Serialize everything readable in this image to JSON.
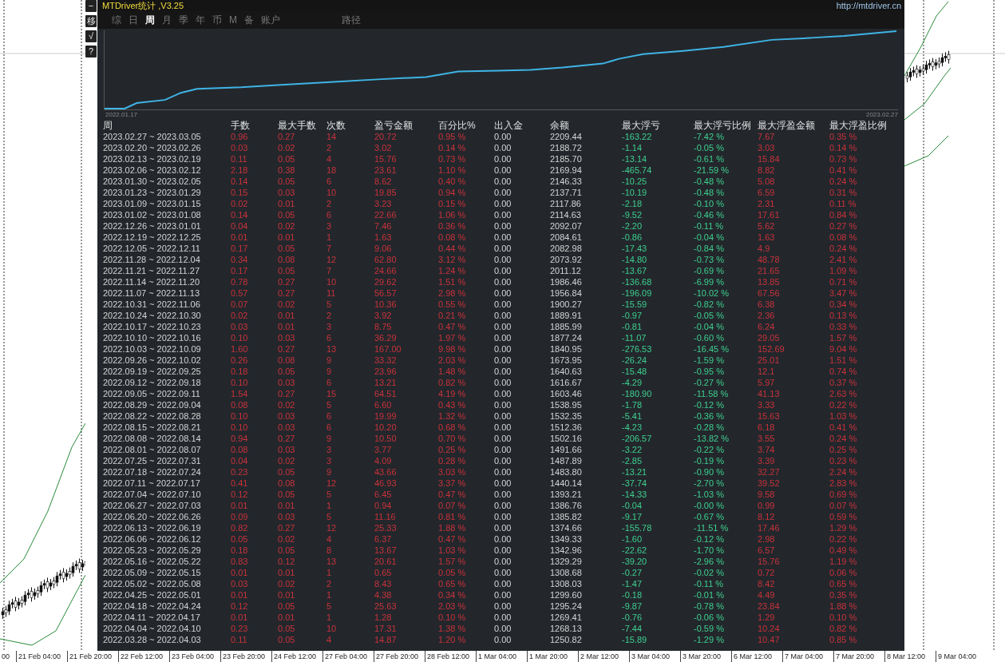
{
  "side_buttons": [
    "−",
    "移",
    "√",
    "?"
  ],
  "window": {
    "title": "MTDriver统计 ,V3.25",
    "link": "http://mtdriver.cn"
  },
  "tabs": [
    {
      "label": "综",
      "selected": false
    },
    {
      "label": "日",
      "selected": false
    },
    {
      "label": "周",
      "selected": true
    },
    {
      "label": "月",
      "selected": false
    },
    {
      "label": "季",
      "selected": false
    },
    {
      "label": "年",
      "selected": false
    },
    {
      "label": "币",
      "selected": false
    },
    {
      "label": "M",
      "selected": false
    },
    {
      "label": "备",
      "selected": false
    },
    {
      "label": "账户",
      "selected": false
    },
    {
      "label": "路径",
      "selected": false
    }
  ],
  "equity_chart": {
    "start_label": "2022.01.17",
    "end_label": "2023.02.27"
  },
  "table": {
    "columns": [
      {
        "label": "周",
        "kind": "plain"
      },
      {
        "label": "手数",
        "kind": "profit"
      },
      {
        "label": "最大手数",
        "kind": "profit"
      },
      {
        "label": "次数",
        "kind": "profit"
      },
      {
        "label": "盈亏金额",
        "kind": "profit"
      },
      {
        "label": "百分比%",
        "kind": "profit"
      },
      {
        "label": "出入金",
        "kind": "plain"
      },
      {
        "label": "余额",
        "kind": "plain"
      },
      {
        "label": "最大浮亏",
        "kind": "loss"
      },
      {
        "label": "最大浮亏比例",
        "kind": "loss"
      },
      {
        "label": "最大浮盈金额",
        "kind": "profit"
      },
      {
        "label": "最大浮盈比例",
        "kind": "profit"
      }
    ],
    "rows": [
      [
        "2023.02.27 ~ 2023.03.05",
        "0.96",
        "0.27",
        "14",
        "20.72",
        "0.95 %",
        "0.00",
        "2209.44",
        "-163.22",
        "-7.42 %",
        "7.67",
        "0.35 %"
      ],
      [
        "2023.02.20 ~ 2023.02.26",
        "0.03",
        "0.02",
        "2",
        "3.02",
        "0.14 %",
        "0.00",
        "2188.72",
        "-1.14",
        "-0.05 %",
        "3.03",
        "0.14 %"
      ],
      [
        "2023.02.13 ~ 2023.02.19",
        "0.11",
        "0.05",
        "4",
        "15.76",
        "0.73 %",
        "0.00",
        "2185.70",
        "-13.14",
        "-0.61 %",
        "15.84",
        "0.73 %"
      ],
      [
        "2023.02.06 ~ 2023.02.12",
        "2.18",
        "0.38",
        "18",
        "23.61",
        "1.10 %",
        "0.00",
        "2169.94",
        "-465.74",
        "-21.59 %",
        "8.82",
        "0.41 %"
      ],
      [
        "2023.01.30 ~ 2023.02.05",
        "0.14",
        "0.05",
        "6",
        "8.62",
        "0.40 %",
        "0.00",
        "2146.33",
        "-10.25",
        "-0.48 %",
        "5.08",
        "0.24 %"
      ],
      [
        "2023.01.23 ~ 2023.01.29",
        "0.15",
        "0.03",
        "10",
        "19.85",
        "0.94 %",
        "0.00",
        "2137.71",
        "-10.19",
        "-0.48 %",
        "6.59",
        "0.31 %"
      ],
      [
        "2023.01.09 ~ 2023.01.15",
        "0.02",
        "0.01",
        "2",
        "3.23",
        "0.15 %",
        "0.00",
        "2117.86",
        "-2.18",
        "-0.10 %",
        "2.31",
        "0.11 %"
      ],
      [
        "2023.01.02 ~ 2023.01.08",
        "0.14",
        "0.05",
        "6",
        "22.66",
        "1.06 %",
        "0.00",
        "2114.63",
        "-9.52",
        "-0.46 %",
        "17.61",
        "0.84 %"
      ],
      [
        "2022.12.26 ~ 2023.01.01",
        "0.04",
        "0.02",
        "3",
        "7.46",
        "0.36 %",
        "0.00",
        "2092.07",
        "-2.20",
        "-0.11 %",
        "5.62",
        "0.27 %"
      ],
      [
        "2022.12.19 ~ 2022.12.25",
        "0.01",
        "0.01",
        "1",
        "1.63",
        "0.08 %",
        "0.00",
        "2084.61",
        "-0.86",
        "-0.04 %",
        "1.63",
        "0.08 %"
      ],
      [
        "2022.12.05 ~ 2022.12.11",
        "0.17",
        "0.05",
        "7",
        "9.06",
        "0.44 %",
        "0.00",
        "2082.98",
        "-17.43",
        "-0.84 %",
        "4.9",
        "0.24 %"
      ],
      [
        "2022.11.28 ~ 2022.12.04",
        "0.34",
        "0.08",
        "12",
        "62.80",
        "3.12 %",
        "0.00",
        "2073.92",
        "-14.80",
        "-0.73 %",
        "48.78",
        "2.41 %"
      ],
      [
        "2022.11.21 ~ 2022.11.27",
        "0.17",
        "0.05",
        "7",
        "24.66",
        "1.24 %",
        "0.00",
        "2011.12",
        "-13.67",
        "-0.69 %",
        "21.65",
        "1.09 %"
      ],
      [
        "2022.11.14 ~ 2022.11.20",
        "0.78",
        "0.27",
        "10",
        "29.62",
        "1.51 %",
        "0.00",
        "1986.46",
        "-136.68",
        "-6.99 %",
        "13.85",
        "0.71 %"
      ],
      [
        "2022.11.07 ~ 2022.11.13",
        "0.57",
        "0.27",
        "11",
        "56.57",
        "2.98 %",
        "0.00",
        "1956.84",
        "-196.09",
        "-10.02 %",
        "67.56",
        "3.47 %"
      ],
      [
        "2022.10.31 ~ 2022.11.06",
        "0.07",
        "0.02",
        "5",
        "10.36",
        "0.55 %",
        "0.00",
        "1900.27",
        "-15.59",
        "-0.82 %",
        "6.38",
        "0.34 %"
      ],
      [
        "2022.10.24 ~ 2022.10.30",
        "0.02",
        "0.01",
        "2",
        "3.92",
        "0.21 %",
        "0.00",
        "1889.91",
        "-0.97",
        "-0.05 %",
        "2.36",
        "0.13 %"
      ],
      [
        "2022.10.17 ~ 2022.10.23",
        "0.03",
        "0.01",
        "3",
        "8.75",
        "0.47 %",
        "0.00",
        "1885.99",
        "-0.81",
        "-0.04 %",
        "6.24",
        "0.33 %"
      ],
      [
        "2022.10.10 ~ 2022.10.16",
        "0.10",
        "0.03",
        "6",
        "36.29",
        "1.97 %",
        "0.00",
        "1877.24",
        "-11.07",
        "-0.60 %",
        "29.05",
        "1.57 %"
      ],
      [
        "2022.10.03 ~ 2022.10.09",
        "1.60",
        "0.27",
        "13",
        "167.00",
        "9.98 %",
        "0.00",
        "1840.95",
        "-276.53",
        "-16.45 %",
        "152.69",
        "9.04 %"
      ],
      [
        "2022.09.26 ~ 2022.10.02",
        "0.26",
        "0.08",
        "9",
        "33.32",
        "2.03 %",
        "0.00",
        "1673.95",
        "-26.24",
        "-1.59 %",
        "25.01",
        "1.51 %"
      ],
      [
        "2022.09.19 ~ 2022.09.25",
        "0.18",
        "0.05",
        "9",
        "23.96",
        "1.48 %",
        "0.00",
        "1640.63",
        "-15.48",
        "-0.95 %",
        "12.1",
        "0.74 %"
      ],
      [
        "2022.09.12 ~ 2022.09.18",
        "0.10",
        "0.03",
        "6",
        "13.21",
        "0.82 %",
        "0.00",
        "1616.67",
        "-4.29",
        "-0.27 %",
        "5.97",
        "0.37 %"
      ],
      [
        "2022.09.05 ~ 2022.09.11",
        "1.54",
        "0.27",
        "15",
        "64.51",
        "4.19 %",
        "0.00",
        "1603.46",
        "-180.90",
        "-11.58 %",
        "41.13",
        "2.63 %"
      ],
      [
        "2022.08.29 ~ 2022.09.04",
        "0.08",
        "0.02",
        "5",
        "6.60",
        "0.43 %",
        "0.00",
        "1538.95",
        "-1.78",
        "-0.12 %",
        "3.33",
        "0.22 %"
      ],
      [
        "2022.08.22 ~ 2022.08.28",
        "0.10",
        "0.03",
        "6",
        "19.99",
        "1.32 %",
        "0.00",
        "1532.35",
        "-5.41",
        "-0.36 %",
        "15.63",
        "1.03 %"
      ],
      [
        "2022.08.15 ~ 2022.08.21",
        "0.10",
        "0.03",
        "6",
        "10.20",
        "0.68 %",
        "0.00",
        "1512.36",
        "-4.23",
        "-0.28 %",
        "6.18",
        "0.41 %"
      ],
      [
        "2022.08.08 ~ 2022.08.14",
        "0.94",
        "0.27",
        "9",
        "10.50",
        "0.70 %",
        "0.00",
        "1502.16",
        "-206.57",
        "-13.82 %",
        "3.55",
        "0.24 %"
      ],
      [
        "2022.08.01 ~ 2022.08.07",
        "0.08",
        "0.03",
        "3",
        "3.77",
        "0.25 %",
        "0.00",
        "1491.66",
        "-3.22",
        "-0.22 %",
        "3.74",
        "0.25 %"
      ],
      [
        "2022.07.25 ~ 2022.07.31",
        "0.04",
        "0.02",
        "3",
        "4.09",
        "0.28 %",
        "0.00",
        "1487.89",
        "-2.85",
        "-0.19 %",
        "3.39",
        "0.23 %"
      ],
      [
        "2022.07.18 ~ 2022.07.24",
        "0.23",
        "0.05",
        "9",
        "43.66",
        "3.03 %",
        "0.00",
        "1483.80",
        "-13.21",
        "-0.90 %",
        "32.27",
        "2.24 %"
      ],
      [
        "2022.07.11 ~ 2022.07.17",
        "0.41",
        "0.08",
        "12",
        "46.93",
        "3.37 %",
        "0.00",
        "1440.14",
        "-37.74",
        "-2.70 %",
        "39.52",
        "2.83 %"
      ],
      [
        "2022.07.04 ~ 2022.07.10",
        "0.12",
        "0.05",
        "5",
        "6.45",
        "0.47 %",
        "0.00",
        "1393.21",
        "-14.33",
        "-1.03 %",
        "9.58",
        "0.69 %"
      ],
      [
        "2022.06.27 ~ 2022.07.03",
        "0.01",
        "0.01",
        "1",
        "0.94",
        "0.07 %",
        "0.00",
        "1386.76",
        "-0.04",
        "-0.00 %",
        "0.99",
        "0.07 %"
      ],
      [
        "2022.06.20 ~ 2022.06.26",
        "0.09",
        "0.03",
        "5",
        "11.16",
        "0.81 %",
        "0.00",
        "1385.82",
        "-9.17",
        "-0.67 %",
        "8.12",
        "0.59 %"
      ],
      [
        "2022.06.13 ~ 2022.06.19",
        "0.82",
        "0.27",
        "12",
        "25.33",
        "1.88 %",
        "0.00",
        "1374.66",
        "-155.78",
        "-11.51 %",
        "17.46",
        "1.29 %"
      ],
      [
        "2022.06.06 ~ 2022.06.12",
        "0.05",
        "0.02",
        "4",
        "6.37",
        "0.47 %",
        "0.00",
        "1349.33",
        "-1.60",
        "-0.12 %",
        "2.98",
        "0.22 %"
      ],
      [
        "2022.05.23 ~ 2022.05.29",
        "0.18",
        "0.05",
        "8",
        "13.67",
        "1.03 %",
        "0.00",
        "1342.96",
        "-22.62",
        "-1.70 %",
        "6.57",
        "0.49 %"
      ],
      [
        "2022.05.16 ~ 2022.05.22",
        "0.83",
        "0.12",
        "13",
        "20.61",
        "1.57 %",
        "0.00",
        "1329.29",
        "-39.20",
        "-2.96 %",
        "15.76",
        "1.19 %"
      ],
      [
        "2022.05.09 ~ 2022.05.15",
        "0.01",
        "0.01",
        "1",
        "0.65",
        "0.05 %",
        "0.00",
        "1308.68",
        "-0.27",
        "-0.02 %",
        "0.72",
        "0.06 %"
      ],
      [
        "2022.05.02 ~ 2022.05.08",
        "0.03",
        "0.02",
        "2",
        "8.43",
        "0.65 %",
        "0.00",
        "1308.03",
        "-1.47",
        "-0.11 %",
        "8.42",
        "0.65 %"
      ],
      [
        "2022.04.25 ~ 2022.05.01",
        "0.01",
        "0.01",
        "1",
        "4.38",
        "0.34 %",
        "0.00",
        "1299.60",
        "-0.18",
        "-0.01 %",
        "4.49",
        "0.35 %"
      ],
      [
        "2022.04.18 ~ 2022.04.24",
        "0.12",
        "0.05",
        "5",
        "25.63",
        "2.03 %",
        "0.00",
        "1295.24",
        "-9.87",
        "-0.78 %",
        "23.84",
        "1.88 %"
      ],
      [
        "2022.04.11 ~ 2022.04.17",
        "0.01",
        "0.01",
        "1",
        "1.28",
        "0.10 %",
        "0.00",
        "1269.41",
        "-0.76",
        "-0.06 %",
        "1.29",
        "0.10 %"
      ],
      [
        "2022.04.04 ~ 2022.04.10",
        "0.23",
        "0.05",
        "10",
        "17.31",
        "1.38 %",
        "0.00",
        "1268.13",
        "-7.44",
        "-0.59 %",
        "10.24",
        "0.82 %"
      ],
      [
        "2022.03.28 ~ 2022.04.03",
        "0.11",
        "0.05",
        "4",
        "14.87",
        "1.20 %",
        "0.00",
        "1250.82",
        "-15.89",
        "-1.29 %",
        "10.47",
        "0.85 %"
      ]
    ]
  },
  "time_axis": [
    "00",
    "21 Feb 04:00",
    "21 Feb 20:00",
    "22 Feb 12:00",
    "23 Feb 04:00",
    "23 Feb 20:00",
    "24 Feb 12:00",
    "27 Feb 04:00",
    "27 Feb 20:00",
    "28 Feb 12:00",
    "1 Mar 04:00",
    "1 Mar 20:00",
    "2 Mar 12:00",
    "3 Mar 04:00",
    "3 Mar 20:00",
    "6 Mar 12:00",
    "7 Mar 04:00",
    "7 Mar 20:00",
    "8 Mar 12:00",
    "9 Mar 04:00"
  ]
}
